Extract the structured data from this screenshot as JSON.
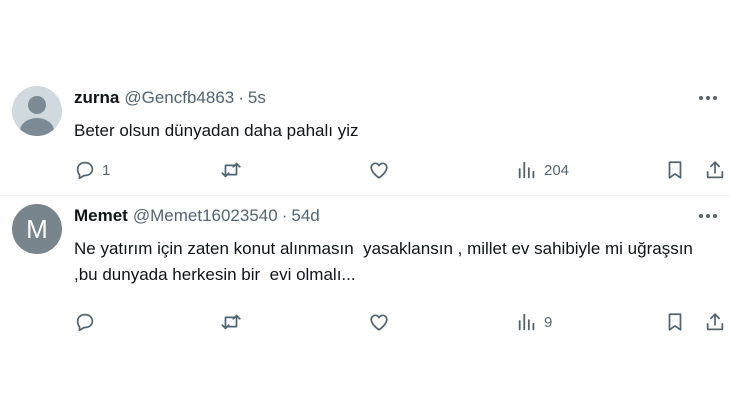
{
  "tweets": [
    {
      "name": "zurna",
      "handle": "@Gencfb4863",
      "separator": "·",
      "time": "5s",
      "avatar": {
        "type": "default-profile"
      },
      "text": "Beter olsun dünyadan daha pahalı yiz",
      "replies": "1",
      "views": "204"
    },
    {
      "name": "Memet",
      "handle": "@Memet16023540",
      "separator": "·",
      "time": "54d",
      "avatar": {
        "type": "letter",
        "letter": "M",
        "color": "#78858d"
      },
      "text": "Ne yatırım için zaten konut alınmasın  yasaklansın , millet ev sahibiyle mi uğraşsın ,bu dunyada herkesin bir  evi olmalı...",
      "replies": "",
      "views": "9"
    }
  ],
  "icons": [
    "reply-icon",
    "retweet-icon",
    "like-icon",
    "views-icon",
    "bookmark-icon",
    "share-icon",
    "more-icon"
  ],
  "colors": {
    "text": "#0f1419",
    "secondary": "#536471",
    "divider": "#eff3f4"
  }
}
